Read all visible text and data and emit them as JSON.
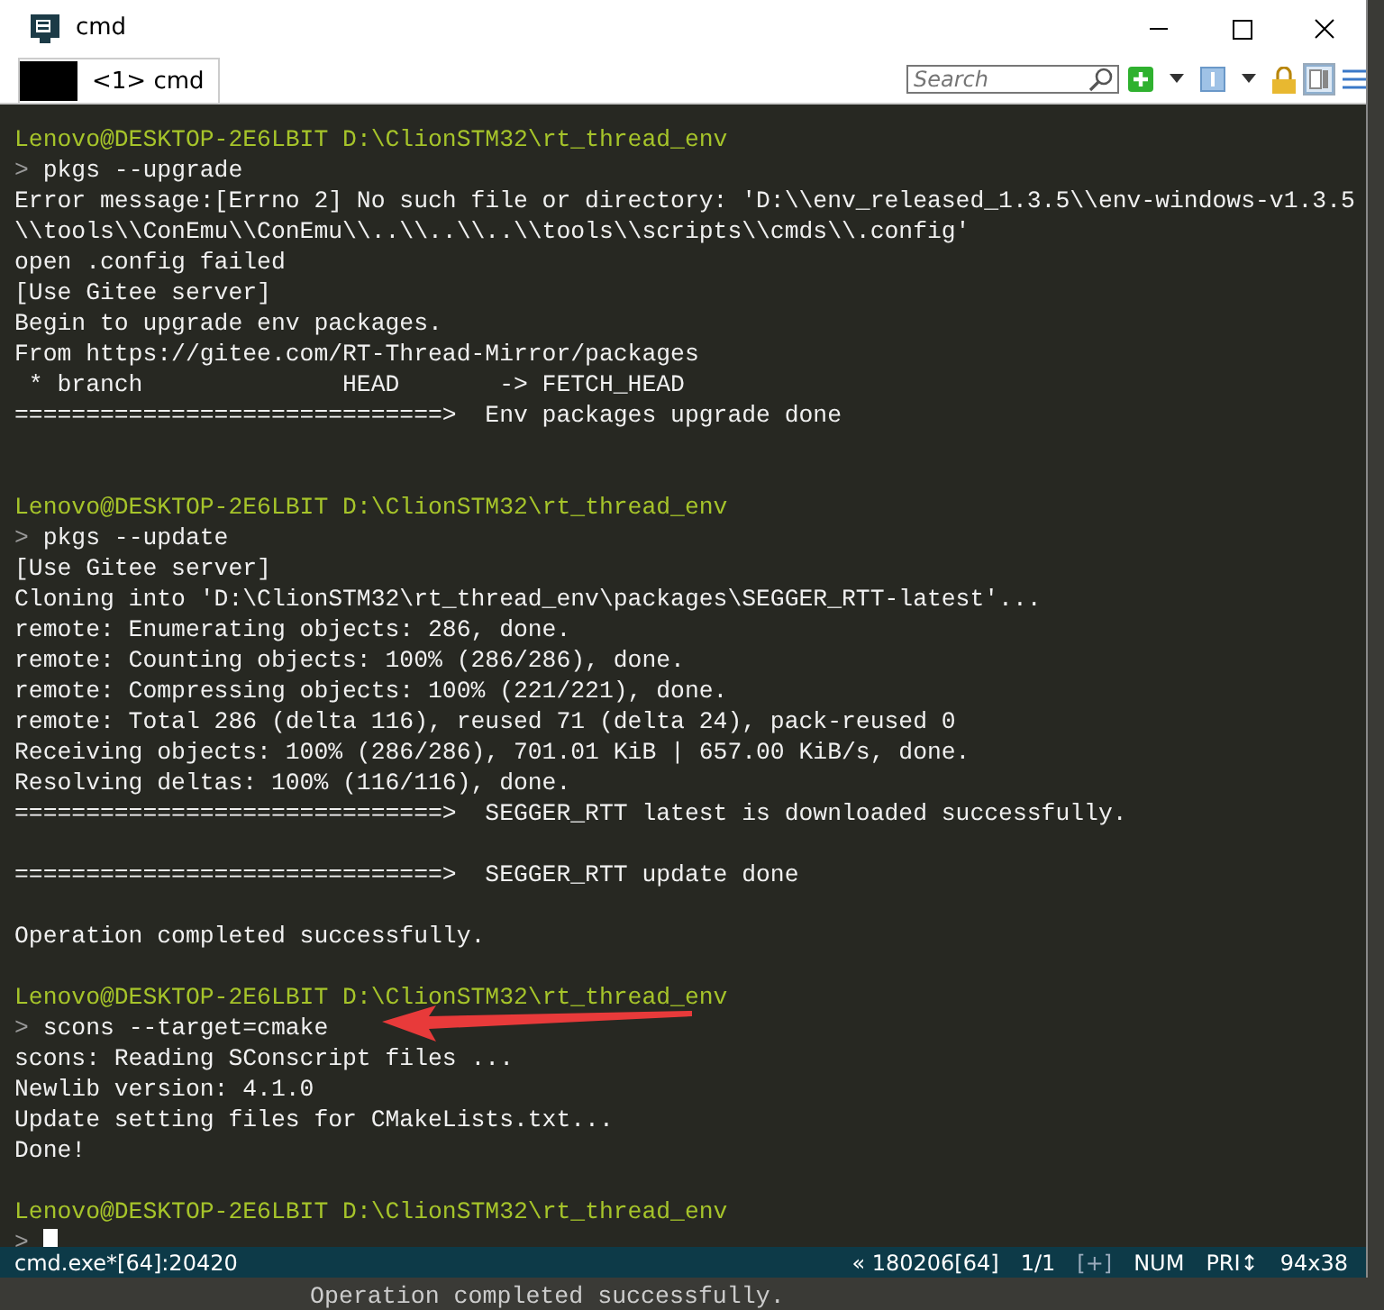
{
  "window": {
    "title": "cmd"
  },
  "tabs": [
    {
      "label": "<1> cmd",
      "selected": true
    }
  ],
  "search": {
    "placeholder": "Search"
  },
  "terminal": {
    "lines": [
      {
        "kind": "prompt",
        "user": "Lenovo@DESKTOP-2E6LBIT",
        "path": "D:\\ClionSTM32\\rt_thread_env"
      },
      {
        "kind": "command",
        "marker": ">",
        "text": "pkgs --upgrade"
      },
      {
        "kind": "output",
        "text": "Error message:[Errno 2] No such file or directory: 'D:\\\\env_released_1.3.5\\\\env-windows-v1.3.5"
      },
      {
        "kind": "output",
        "text": "\\\\tools\\\\ConEmu\\\\ConEmu\\\\..\\\\..\\\\..\\\\tools\\\\scripts\\\\cmds\\\\.config'"
      },
      {
        "kind": "output",
        "text": "open .config failed"
      },
      {
        "kind": "output",
        "text": "[Use Gitee server]"
      },
      {
        "kind": "output",
        "text": "Begin to upgrade env packages."
      },
      {
        "kind": "output",
        "text": "From https://gitee.com/RT-Thread-Mirror/packages"
      },
      {
        "kind": "output",
        "text": " * branch              HEAD       -> FETCH_HEAD"
      },
      {
        "kind": "output",
        "text": "==============================>  Env packages upgrade done"
      },
      {
        "kind": "blank"
      },
      {
        "kind": "blank"
      },
      {
        "kind": "prompt",
        "user": "Lenovo@DESKTOP-2E6LBIT",
        "path": "D:\\ClionSTM32\\rt_thread_env"
      },
      {
        "kind": "command",
        "marker": ">",
        "text": "pkgs --update"
      },
      {
        "kind": "output",
        "text": "[Use Gitee server]"
      },
      {
        "kind": "output",
        "text": "Cloning into 'D:\\ClionSTM32\\rt_thread_env\\packages\\SEGGER_RTT-latest'..."
      },
      {
        "kind": "output",
        "text": "remote: Enumerating objects: 286, done."
      },
      {
        "kind": "output",
        "text": "remote: Counting objects: 100% (286/286), done."
      },
      {
        "kind": "output",
        "text": "remote: Compressing objects: 100% (221/221), done."
      },
      {
        "kind": "output",
        "text": "remote: Total 286 (delta 116), reused 71 (delta 24), pack-reused 0"
      },
      {
        "kind": "output",
        "text": "Receiving objects: 100% (286/286), 701.01 KiB | 657.00 KiB/s, done."
      },
      {
        "kind": "output",
        "text": "Resolving deltas: 100% (116/116), done."
      },
      {
        "kind": "output",
        "text": "==============================>  SEGGER_RTT latest is downloaded successfully."
      },
      {
        "kind": "blank"
      },
      {
        "kind": "output",
        "text": "==============================>  SEGGER_RTT update done"
      },
      {
        "kind": "blank"
      },
      {
        "kind": "output",
        "text": "Operation completed successfully."
      },
      {
        "kind": "blank"
      },
      {
        "kind": "prompt",
        "user": "Lenovo@DESKTOP-2E6LBIT",
        "path": "D:\\ClionSTM32\\rt_thread_env"
      },
      {
        "kind": "command",
        "marker": ">",
        "text": "scons --target=cmake",
        "annotated": true
      },
      {
        "kind": "output",
        "text": "scons: Reading SConscript files ..."
      },
      {
        "kind": "output",
        "text": "Newlib version: 4.1.0"
      },
      {
        "kind": "output",
        "text": "Update setting files for CMakeLists.txt..."
      },
      {
        "kind": "output",
        "text": "Done!"
      },
      {
        "kind": "blank"
      },
      {
        "kind": "prompt",
        "user": "Lenovo@DESKTOP-2E6LBIT",
        "path": "D:\\ClionSTM32\\rt_thread_env"
      },
      {
        "kind": "cursor",
        "marker": ">"
      }
    ]
  },
  "status_bar": {
    "process": "cmd.exe*[64]:20420",
    "items": [
      "« 180206[64]",
      "1/1",
      "[+]",
      "NUM",
      "PRI↕",
      "94x38"
    ]
  },
  "background_window": {
    "text": "Operation completed successfully."
  }
}
